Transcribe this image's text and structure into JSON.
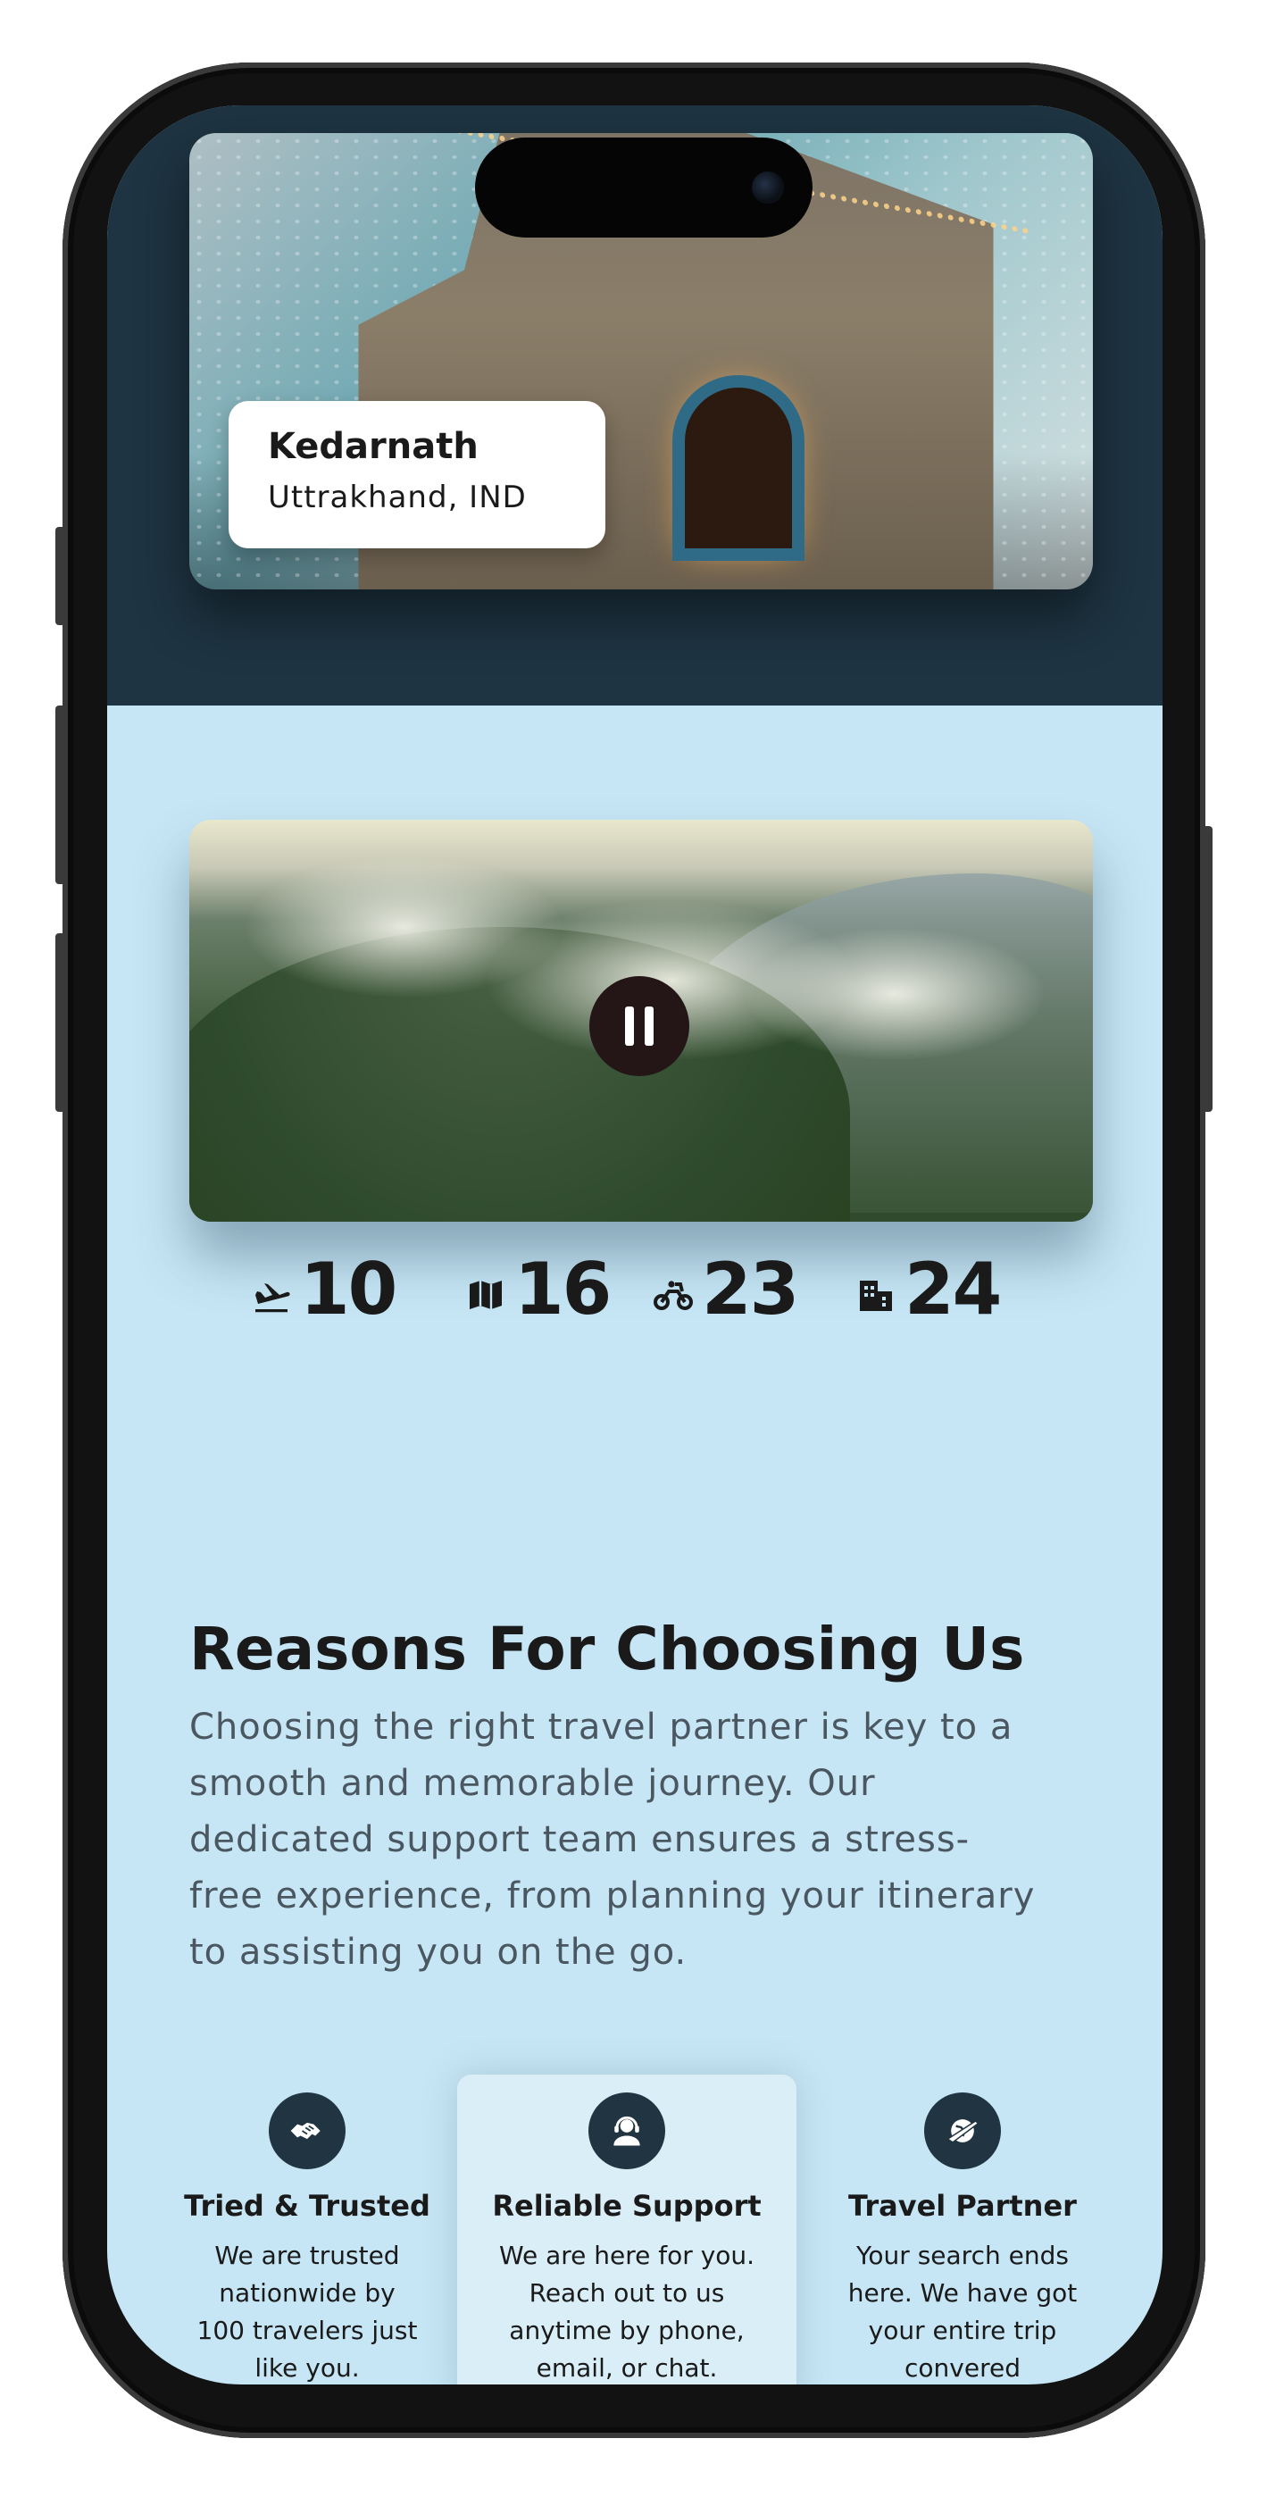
{
  "hero": {
    "location_name": "Kedarnath",
    "location_region": "Uttrakhand, IND"
  },
  "video": {
    "control_icon": "pause-icon"
  },
  "stats": [
    {
      "icon": "flight-landing-icon",
      "value": "10"
    },
    {
      "icon": "map-icon",
      "value": "16"
    },
    {
      "icon": "motorbike-icon",
      "value": "23"
    },
    {
      "icon": "building-icon",
      "value": "24"
    }
  ],
  "reasons": {
    "title": "Reasons For Choosing Us",
    "line1": "Choosing the right travel partner is key to a",
    "line2": "smooth and memorable journey. Our",
    "line3": "dedicated support team ensures a stress-",
    "line4": "free experience, from planning your itinerary",
    "line5": "to assisting you on the go."
  },
  "features": [
    {
      "icon": "handshake-icon",
      "title": "Tried & Trusted",
      "desc": [
        "We are trusted",
        "nationwide by",
        "100 travelers just",
        "like you."
      ]
    },
    {
      "icon": "support-agent-icon",
      "title": "Reliable Support",
      "desc": [
        "We are here for you.",
        "Reach out to us",
        "anytime by phone,",
        "email, or chat."
      ]
    },
    {
      "icon": "travel-globe-icon",
      "title": "Travel Partner",
      "desc": [
        "Your search ends",
        "here. We have got",
        "your entire trip",
        "convered"
      ]
    }
  ],
  "colors": {
    "header_bg": "#1e3442",
    "page_bg": "#c6e6f5",
    "icon_circle": "#203541",
    "text_dark": "#1a1a1a",
    "text_muted": "#4a5760"
  }
}
